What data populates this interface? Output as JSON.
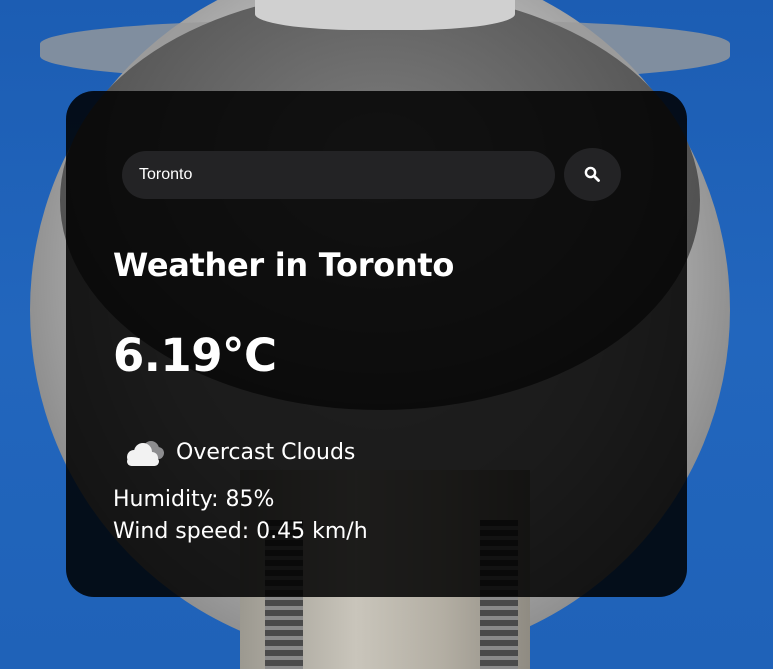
{
  "search": {
    "value": "Toronto",
    "placeholder": "Search"
  },
  "weather": {
    "title": "Weather in Toronto",
    "temperature": "6.19°C",
    "condition": "Overcast Clouds",
    "humidity": "Humidity: 85%",
    "wind": "Wind speed: 0.45 km/h"
  },
  "icons": {
    "search": "search-icon",
    "condition": "cloud-icon"
  },
  "colors": {
    "card": "#000000",
    "field": "#232325",
    "text": "#ffffff"
  }
}
